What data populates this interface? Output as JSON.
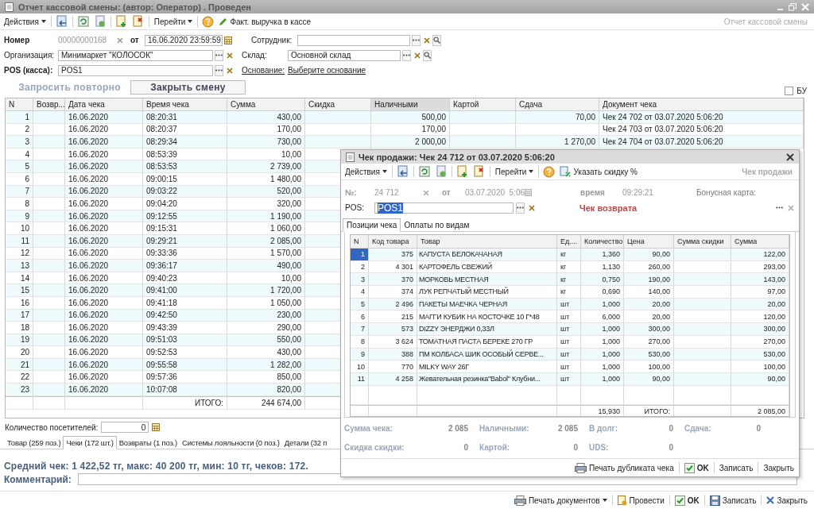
{
  "window": {
    "title": "Отчет кассовой смены:  (автор: Оператор) . Проведен"
  },
  "toolbar": {
    "actions": "Действия",
    "goto": "Перейти",
    "cash_fact": "Факт. выручка в кассе",
    "form_name": "Отчет кассовой смены"
  },
  "header": {
    "number_label": "Номер",
    "number": "00000000168",
    "date_label": "от",
    "date": "16.06.2020 23:59:59",
    "employee_label": "Сотрудник:",
    "organization_label": "Организация:",
    "organization": "Минимаркет \"КОЛОСОК\"",
    "warehouse_label": "Склад:",
    "warehouse": "Основной склад",
    "pos_label": "POS (касса):",
    "pos": "POS1",
    "basis_label": "Основание:",
    "basis": "Выберите основание"
  },
  "buttons": [
    {
      "label": "Запросить повторно",
      "disabled": true
    },
    {
      "label": "Закрыть смену",
      "disabled": false
    }
  ],
  "bu_checkbox": {
    "label": "БУ",
    "checked": false
  },
  "table": {
    "columns": [
      "N",
      "Возвр...",
      "Дата чека",
      "Время чека",
      "Сумма",
      "Скидка",
      "Наличными",
      "Картой",
      "Сдача",
      "Документ чека"
    ],
    "rows": [
      {
        "n": "1",
        "date": "16.06.2020",
        "time": "08:20:31",
        "sum": "430,00",
        "cash": "500,00",
        "change": "70,00",
        "doc": "Чек 24 702 от 03.07.2020 5:06:20"
      },
      {
        "n": "2",
        "date": "16.06.2020",
        "time": "08:20:37",
        "sum": "170,00",
        "cash": "170,00",
        "doc": "Чек 24 703 от 03.07.2020 5:06:20"
      },
      {
        "n": "3",
        "date": "16.06.2020",
        "time": "08:29:34",
        "sum": "730,00",
        "cash": "2 000,00",
        "change": "1 270,00",
        "doc": "Чек 24 704 от 03.07.2020 5:06:20"
      },
      {
        "n": "4",
        "date": "16.06.2020",
        "time": "08:53:39",
        "sum": "10,00"
      },
      {
        "n": "5",
        "date": "16.06.2020",
        "time": "08:53:53",
        "sum": "2 739,00"
      },
      {
        "n": "6",
        "date": "16.06.2020",
        "time": "09:00:15",
        "sum": "1 480,00"
      },
      {
        "n": "7",
        "date": "16.06.2020",
        "time": "09:03:22",
        "sum": "520,00"
      },
      {
        "n": "8",
        "date": "16.06.2020",
        "time": "09:04:20",
        "sum": "320,00"
      },
      {
        "n": "9",
        "date": "16.06.2020",
        "time": "09:12:55",
        "sum": "1 190,00"
      },
      {
        "n": "10",
        "date": "16.06.2020",
        "time": "09:15:31",
        "sum": "1 060,00"
      },
      {
        "n": "11",
        "date": "16.06.2020",
        "time": "09:29:21",
        "sum": "2 085,00"
      },
      {
        "n": "12",
        "date": "16.06.2020",
        "time": "09:33:36",
        "sum": "1 570,00"
      },
      {
        "n": "13",
        "date": "16.06.2020",
        "time": "09:36:17",
        "sum": "490,00"
      },
      {
        "n": "14",
        "date": "16.06.2020",
        "time": "09:40:23",
        "sum": "10,00"
      },
      {
        "n": "15",
        "date": "16.06.2020",
        "time": "09:41:00",
        "sum": "1 720,00"
      },
      {
        "n": "16",
        "date": "16.06.2020",
        "time": "09:41:18",
        "sum": "1 050,00"
      },
      {
        "n": "17",
        "date": "16.06.2020",
        "time": "09:42:50",
        "sum": "230,00"
      },
      {
        "n": "18",
        "date": "16.06.2020",
        "time": "09:43:39",
        "sum": "290,00"
      },
      {
        "n": "19",
        "date": "16.06.2020",
        "time": "09:51:03",
        "sum": "550,00"
      },
      {
        "n": "20",
        "date": "16.06.2020",
        "time": "09:52:53",
        "sum": "430,00"
      },
      {
        "n": "21",
        "date": "16.06.2020",
        "time": "09:55:58",
        "sum": "1 282,00"
      },
      {
        "n": "22",
        "date": "16.06.2020",
        "time": "09:57:36",
        "sum": "850,00"
      },
      {
        "n": "23",
        "date": "16.06.2020",
        "time": "10:07:08",
        "sum": "820,00"
      }
    ],
    "total_label": "ИТОГО:",
    "total": "244 674,00"
  },
  "visitors": {
    "label": "Количество посетителей:",
    "value": "0"
  },
  "tabs": [
    {
      "label": "Товар (259 поз.)",
      "selected": false
    },
    {
      "label": "Чеки (172 шт.)",
      "selected": true
    },
    {
      "label": "Возвраты (1 поз.)",
      "selected": false
    },
    {
      "label": "Системы лояльности (0 поз.)",
      "selected": false
    },
    {
      "label": "Детали (32 п",
      "selected": false
    }
  ],
  "summary": "Средний чек: 1 422,52 тг, макс: 40 200 тг, мин: 10 тг, чеков: 172.",
  "comment_label": "Комментарий:",
  "footer": {
    "print": "Печать документов",
    "post": "Провести",
    "ok": "OK",
    "save": "Записать",
    "close": "Закрыть"
  },
  "dialog": {
    "title": "Чек продажи: Чек 24 712 от 03.07.2020 5:06:20",
    "toolbar": {
      "actions": "Действия",
      "goto": "Перейти",
      "discount": "Указать скидку %",
      "form_name": "Чек продажи"
    },
    "number_label": "№:",
    "number": "24 712",
    "date_label": "от",
    "date": "03.07.2020  5:06",
    "time_label": "время",
    "time": "09:29:21",
    "bonus_label": "Бонусная карта:",
    "pos_label": "POS:",
    "pos": "POS1",
    "pos_highlighted": true,
    "return_label": "Чек возврата",
    "tabs": [
      {
        "label": "Позиции чека",
        "selected": true
      },
      {
        "label": "Оплаты по видам",
        "selected": false
      }
    ],
    "columns": [
      "N",
      "Код товара",
      "Товар",
      "Ед....",
      "Количество",
      "Цена",
      "Сумма скидки",
      "Сумма"
    ],
    "rows": [
      {
        "n": "1",
        "code": "375",
        "name": "КАПУСТА БЕЛОКАЧАНАЯ",
        "unit": "кг",
        "qty": "1,360",
        "price": "90,00",
        "sum": "122,00",
        "selected": true
      },
      {
        "n": "2",
        "code": "4 301",
        "name": "КАРТОФЕЛЬ СВЕЖИЙ",
        "unit": "кг",
        "qty": "1,130",
        "price": "260,00",
        "sum": "293,00",
        "selected": false
      },
      {
        "n": "3",
        "code": "370",
        "name": "МОРКОВЬ МЕСТНАЯ",
        "unit": "кг",
        "qty": "0,750",
        "price": "190,00",
        "sum": "143,00",
        "selected": false
      },
      {
        "n": "4",
        "code": "374",
        "name": "ЛУК РЕПЧАТЫЙ МЕСТНЫЙ",
        "unit": "кг",
        "qty": "0,690",
        "price": "140,00",
        "sum": "97,00",
        "selected": false
      },
      {
        "n": "5",
        "code": "2 496",
        "name": "ПАКЕТЫ МАЕЧКА ЧЕРНАЯ",
        "unit": "шт",
        "qty": "1,000",
        "price": "20,00",
        "sum": "20,00",
        "selected": false
      },
      {
        "n": "6",
        "code": "215",
        "name": "МАГГИ  КУБИК НА КОСТОЧКЕ 10 Г*48",
        "unit": "шт",
        "qty": "6,000",
        "price": "20,00",
        "sum": "120,00",
        "selected": false
      },
      {
        "n": "7",
        "code": "573",
        "name": "DIZZY  ЭНЕРДЖИ 0,33Л",
        "unit": "шт",
        "qty": "1,000",
        "price": "300,00",
        "sum": "300,00",
        "selected": false
      },
      {
        "n": "8",
        "code": "3 624",
        "name": "ТОМАТНАЯ ПАСТА БЕРЕКЕ 270 ГР",
        "unit": "шт",
        "qty": "1,000",
        "price": "270,00",
        "sum": "270,00",
        "selected": false
      },
      {
        "n": "9",
        "code": "388",
        "name": "ПМ КОЛБАСА ШИК ОСОБЫЙ СЕРВЕ...",
        "unit": "шт",
        "qty": "1,000",
        "price": "530,00",
        "sum": "530,00",
        "selected": false
      },
      {
        "n": "10",
        "code": "770",
        "name": "MILKY WAY 26Г",
        "unit": "шт",
        "qty": "1,000",
        "price": "100,00",
        "sum": "100,00",
        "selected": false
      },
      {
        "n": "11",
        "code": "4 258",
        "name": "Жевательная резинка\"Babol\" Клубни...",
        "unit": "шт",
        "qty": "1,000",
        "price": "90,00",
        "sum": "90,00",
        "selected": false
      }
    ],
    "total_qty": "15,930",
    "total_label": "ИТОГО:",
    "total": "2 085,00",
    "totals": [
      [
        {
          "label": "Сумма чека:",
          "value": "2 085"
        },
        {
          "label": "Наличными:",
          "value": "2 085"
        },
        {
          "label": "В долг:",
          "value": "0"
        },
        {
          "label": "Сдача:",
          "value": "0"
        }
      ],
      [
        {
          "label": "Скидка скидки:",
          "value": "0"
        },
        {
          "label": "Картой:",
          "value": "0"
        },
        {
          "label": "UDS:",
          "value": "0"
        }
      ]
    ],
    "footer": {
      "print": "Печать дубликата чека",
      "ok": "OK",
      "save": "Записать",
      "close": "Закрыть"
    }
  }
}
